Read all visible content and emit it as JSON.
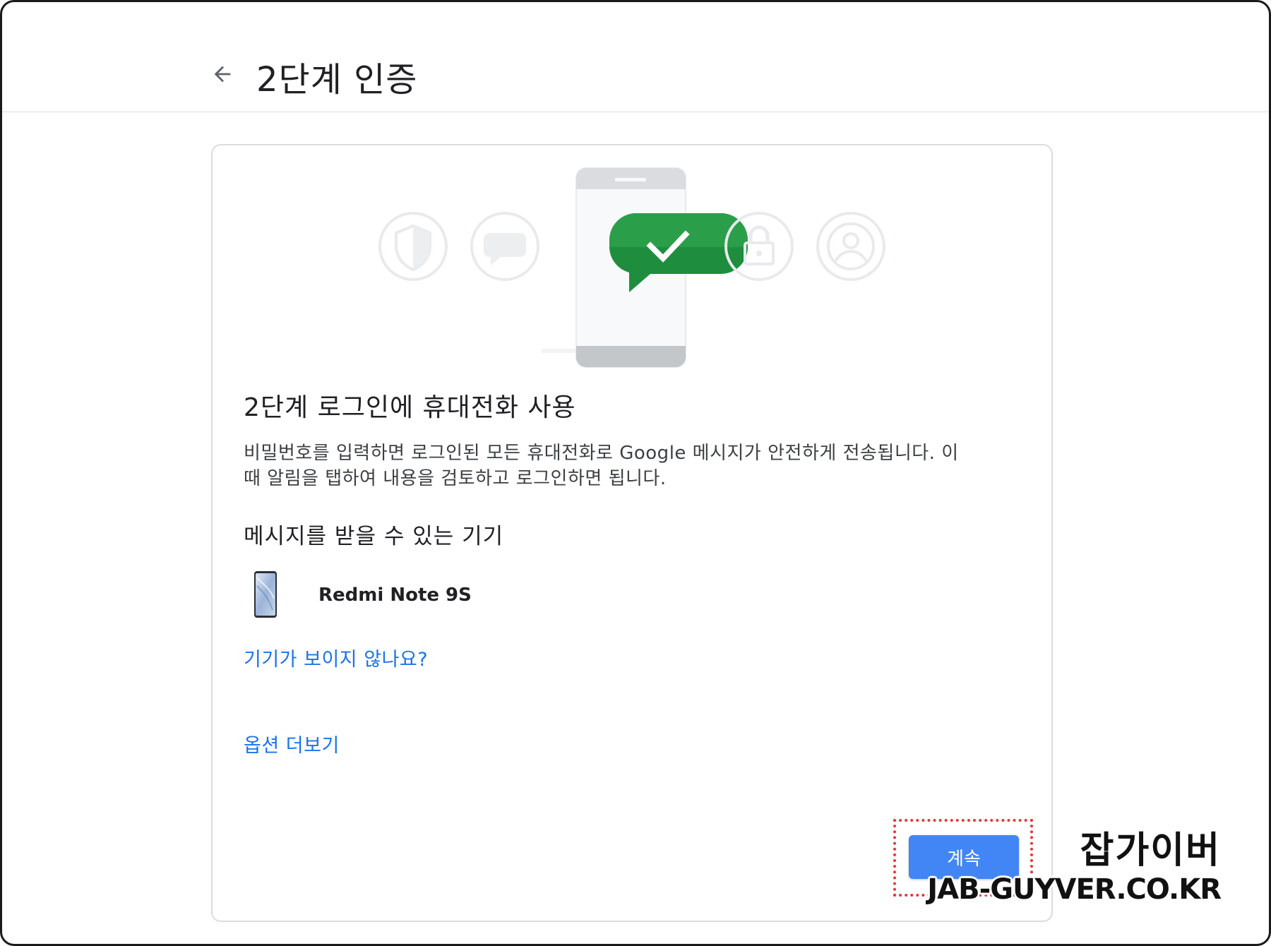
{
  "header": {
    "title": "2단계 인증"
  },
  "card": {
    "heading": "2단계 로그인에 휴대전화 사용",
    "description_line1": "비밀번호를 입력하면 로그인된 모든 휴대전화로 Google 메시지가 안전하게 전송됩니다. 이",
    "description_line2": "때 알림을 탭하여 내용을 검토하고 로그인하면 됩니다.",
    "devices_heading": "메시지를 받을 수 있는 기기",
    "device_name": "Redmi Note 9S",
    "no_device_link": "기기가 보이지 않나요?",
    "more_options_link": "옵션 더보기",
    "continue_label": "계속"
  },
  "watermark": {
    "korean": "잡가이버",
    "english": "JAB-GUYVER.CO.KR"
  },
  "colors": {
    "accent": "#1a73e8",
    "button": "#4285f4",
    "success_bubble": "#1e8e3e",
    "highlight": "#e53935"
  }
}
